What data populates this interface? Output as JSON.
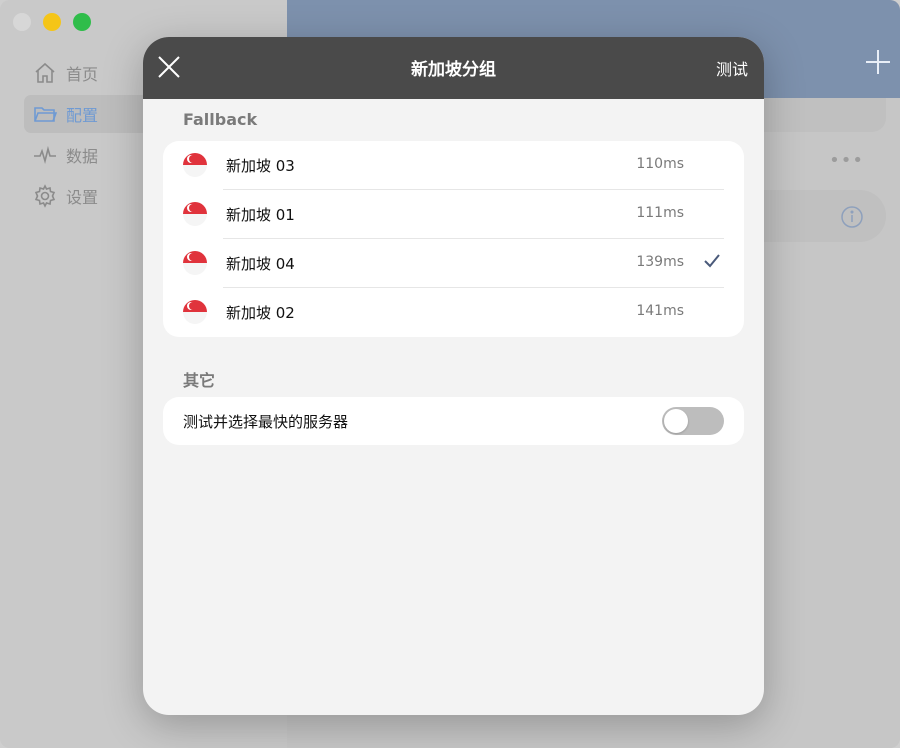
{
  "sidebar": {
    "items": [
      {
        "label": "首页",
        "icon": "home-icon"
      },
      {
        "label": "配置",
        "icon": "folder-icon"
      },
      {
        "label": "数据",
        "icon": "activity-icon"
      },
      {
        "label": "设置",
        "icon": "gear-icon"
      }
    ]
  },
  "modal": {
    "title": "新加坡分组",
    "test_label": "测试",
    "sections": [
      {
        "title": "Fallback",
        "servers": [
          {
            "name": "新加坡 03",
            "latency": "110ms",
            "selected": false
          },
          {
            "name": "新加坡 01",
            "latency": "111ms",
            "selected": false
          },
          {
            "name": "新加坡 04",
            "latency": "139ms",
            "selected": true
          },
          {
            "name": "新加坡 02",
            "latency": "141ms",
            "selected": false
          }
        ]
      },
      {
        "title": "其它",
        "toggle_label": "测试并选择最快的服务器",
        "toggle_on": false
      }
    ]
  },
  "colors": {
    "header_bg": "#4a4a4a",
    "main_header": "#7d91ad",
    "accent": "#6f9ad3",
    "flag_red": "#e0333c"
  }
}
